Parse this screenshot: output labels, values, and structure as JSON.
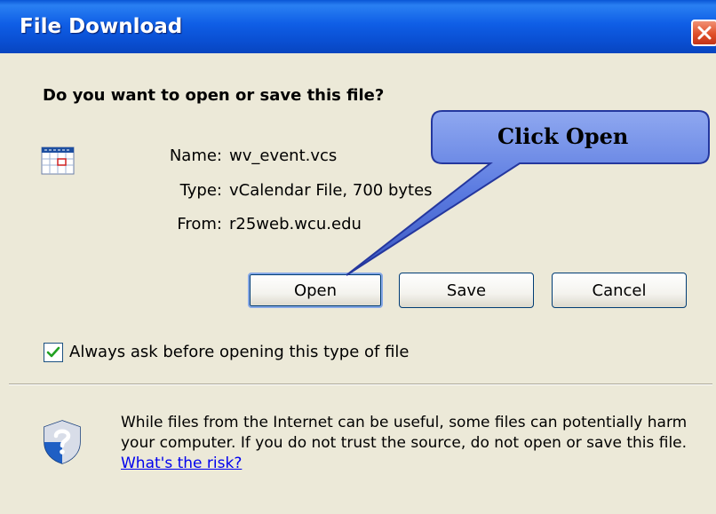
{
  "window": {
    "title": "File Download",
    "close_icon": "close-icon"
  },
  "dialog": {
    "question": "Do you want to open or save this file?",
    "file_icon": "calendar-icon",
    "fields": [
      {
        "label": "Name:",
        "value": "wv_event.vcs"
      },
      {
        "label": "Type:",
        "value": "vCalendar File, 700 bytes"
      },
      {
        "label": "From:",
        "value": "r25web.wcu.edu"
      }
    ],
    "buttons": {
      "open": "Open",
      "save": "Save",
      "cancel": "Cancel"
    },
    "checkbox": {
      "label": "Always ask before opening this type of file",
      "checked": true
    },
    "warning": {
      "icon": "shield-question-icon",
      "text": "While files from the Internet can be useful, some files can potentially harm your computer. If you do not trust the source, do not open or save this file.",
      "link": "What's the risk?"
    }
  },
  "annotation": {
    "callout_text": "Click Open"
  },
  "colors": {
    "title_bar": "#0a50d4",
    "dialog_bg": "#ece9d8",
    "close_button": "#e0502a",
    "callout_fill": "#5a7ae0",
    "link": "#0000ee"
  }
}
